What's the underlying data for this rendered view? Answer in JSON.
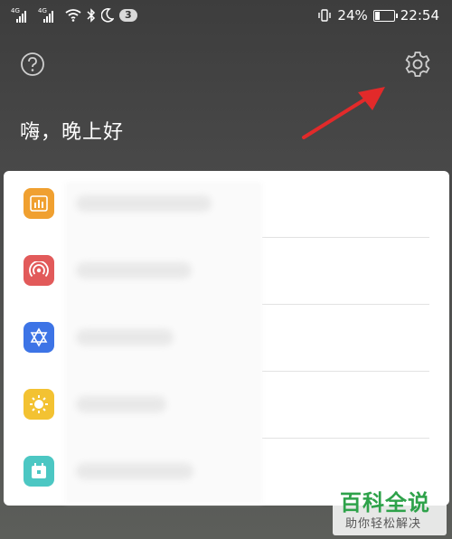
{
  "status_bar": {
    "signal1_tag": "4G",
    "signal2_tag": "4G",
    "notification_count": "3",
    "battery_percent": "24%",
    "battery_level": 0.24,
    "time": "22:54"
  },
  "header": {
    "greeting": "嗨，晚上好"
  },
  "list": {
    "items": [
      {
        "icon": "bar-chart-icon",
        "color": "#f0a030"
      },
      {
        "icon": "wireless-signal-icon",
        "color": "#e25a5a"
      },
      {
        "icon": "star-of-david-icon",
        "color": "#3d74e6"
      },
      {
        "icon": "sun-icon",
        "color": "#f3c232"
      },
      {
        "icon": "calendar-icon",
        "color": "#4cc7c3"
      }
    ]
  },
  "watermark": {
    "title": "百科全说",
    "subtitle": "助你轻松解决"
  },
  "colors": {
    "accent_arrow": "#e22a2a",
    "watermark_green": "#2ea24a"
  }
}
